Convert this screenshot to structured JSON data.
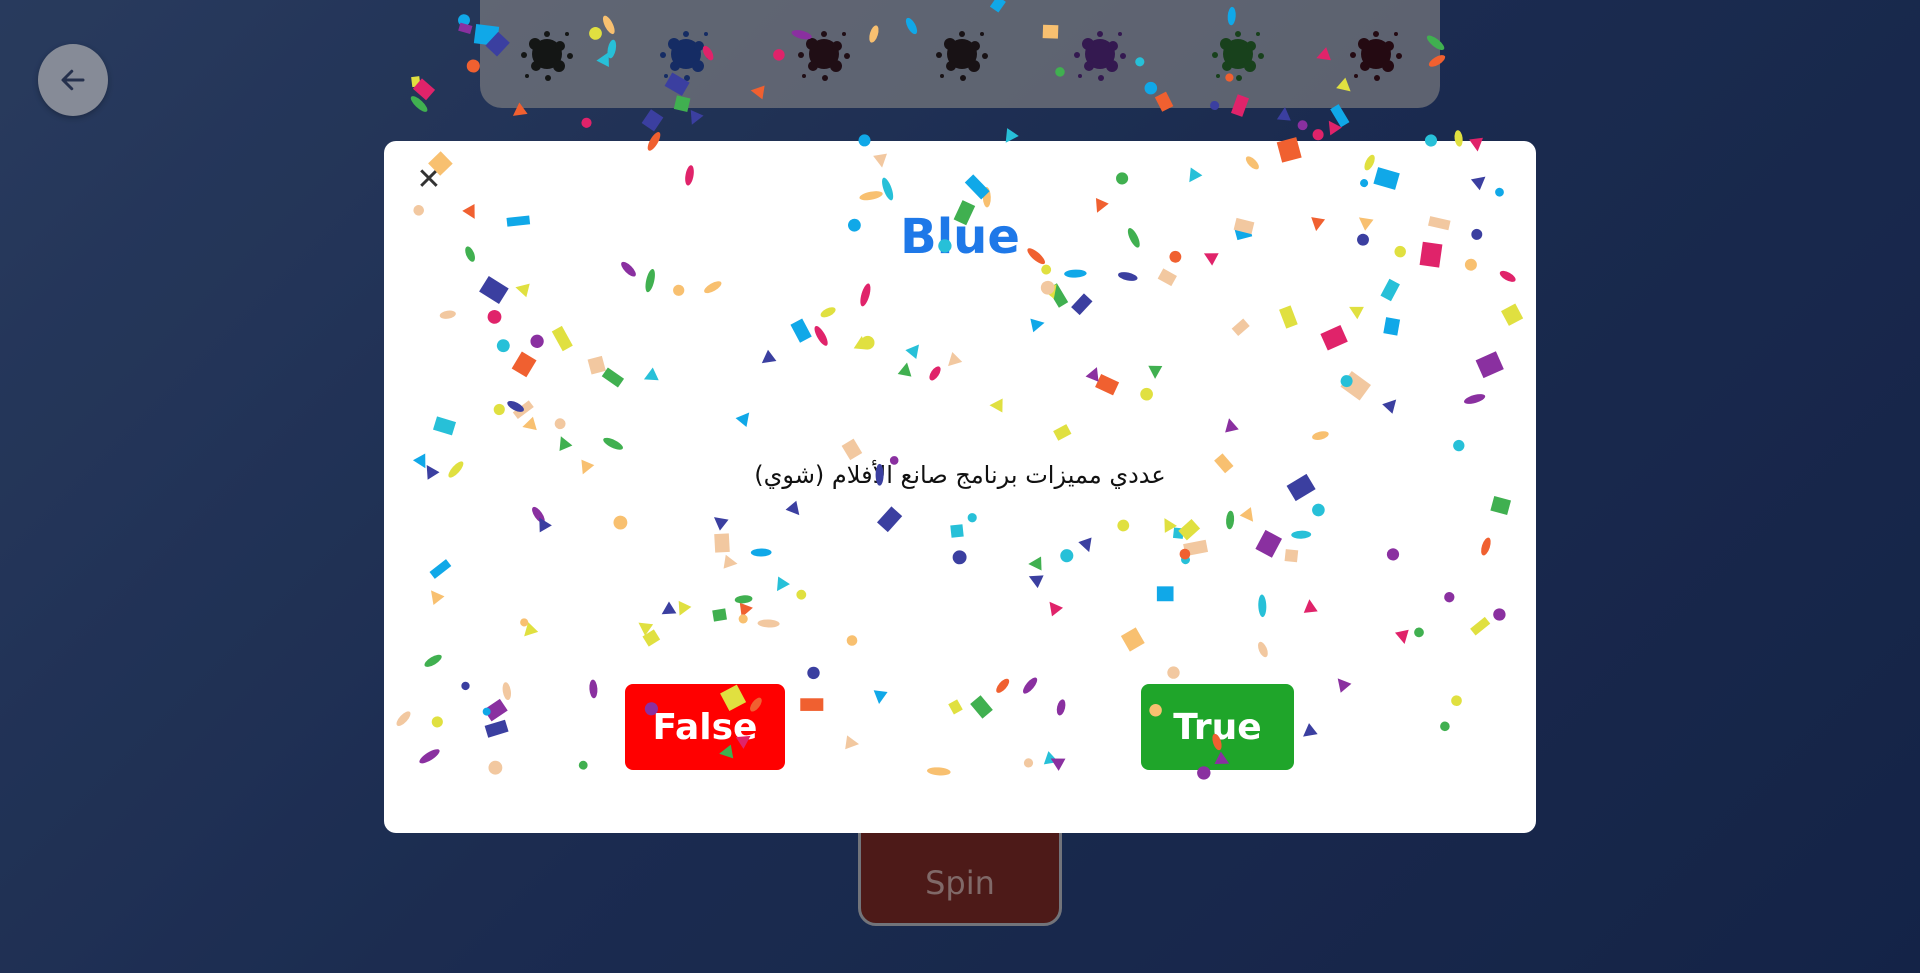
{
  "nav": {
    "back_icon": "arrow-left-icon"
  },
  "color_bar": {
    "splats": [
      {
        "name": "black-splat-icon",
        "color": "#15140c"
      },
      {
        "name": "blue-splat-icon",
        "color": "#16306e"
      },
      {
        "name": "dark-red-splat-icon",
        "color": "#240a0c"
      },
      {
        "name": "black-splat-icon",
        "color": "#1a100c"
      },
      {
        "name": "purple-splat-icon",
        "color": "#3d1856"
      },
      {
        "name": "green-splat-icon",
        "color": "#1a4a14"
      },
      {
        "name": "dark-red-splat-icon",
        "color": "#280608"
      }
    ]
  },
  "spin": {
    "label": "Spin"
  },
  "modal": {
    "close_label": "✕",
    "title": "Blue",
    "title_color": "#1e78e8",
    "question": "عددي مميزات برنامج صانع الأفلام (شوي)",
    "false_label": "False",
    "true_label": "True",
    "false_color": "#ff0000",
    "true_color": "#1fa52a"
  },
  "confetti_colors": [
    "#3b3fa0",
    "#e0236a",
    "#27c0d8",
    "#f2c8a0",
    "#e0e040",
    "#f06030",
    "#40b050",
    "#8a30a0",
    "#10a8e8",
    "#f8c070"
  ]
}
